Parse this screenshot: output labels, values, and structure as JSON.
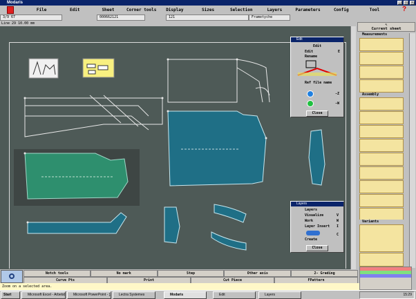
{
  "window": {
    "title": "Modaris"
  },
  "menu": [
    "File",
    "Edit",
    "Sheet",
    "Corner tools",
    "Display",
    "Sizes",
    "Selection",
    "Layers",
    "Parameters",
    "Config",
    "Tool"
  ],
  "info": {
    "size": "3/9 67",
    "code": "000662121",
    "num": "121",
    "name": "Frametyche",
    "line": "Line 29 10.00 mm"
  },
  "right_panel": {
    "header": "Current sheet",
    "sections": [
      "Measurements",
      "Assembly",
      "Variants"
    ]
  },
  "edit_dialog": {
    "title": "Edit",
    "label1": "Edit",
    "label2": "Edit",
    "val2": "E",
    "label3": "Rename",
    "ref": "Ref file name",
    "v1": "-Z",
    "v2": "-W",
    "close": "Close"
  },
  "layers_dialog": {
    "title": "Layers",
    "rows": [
      {
        "label": "Layers",
        "key": ""
      },
      {
        "label": "Visualize",
        "key": "V"
      },
      {
        "label": "Work",
        "key": "W"
      },
      {
        "label": "Layer Insert",
        "key": "I"
      },
      {
        "label": "Create",
        "key": "C"
      }
    ],
    "close": "Close"
  },
  "bottom": {
    "row1": [
      "Notch tools",
      "No mark",
      "Step",
      "Other axis",
      "2- Grading"
    ],
    "row2": [
      "Curve Pts",
      "Print",
      "Cut Piece",
      "FPattern"
    ]
  },
  "status": "Zoom on a selected area.",
  "taskbar": {
    "start": "Start",
    "items": [
      "Microsoft Excel - Arbetsbok1",
      "Microsoft PowerPoint - [...",
      "Lectra Systemes",
      "Modaris",
      "Edit",
      "Layers"
    ],
    "clock": "15:29"
  }
}
